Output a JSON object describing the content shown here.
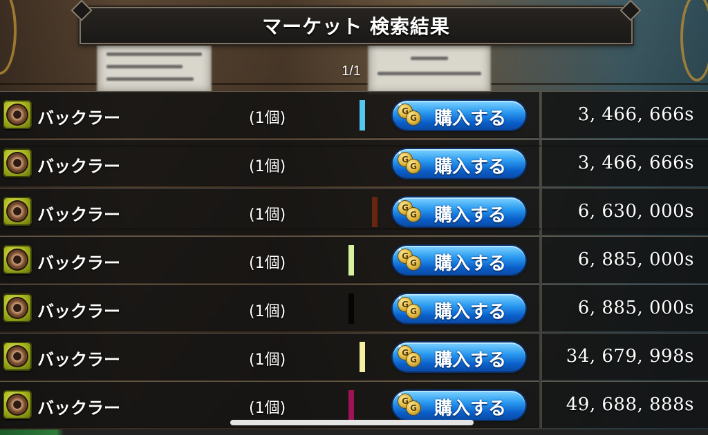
{
  "title": "マーケット 検索結果",
  "page_indicator": "1/1",
  "buy_label": "購入する",
  "listings": [
    {
      "name": "バックラー",
      "qty": "(1個)",
      "color": "#55c6f0",
      "price": "3, 466, 666s"
    },
    {
      "name": "バックラー",
      "qty": "(1個)",
      "color": "",
      "price": "3, 466, 666s"
    },
    {
      "name": "バックラー",
      "qty": "(1個)",
      "color": "#6a2412",
      "price": "6, 630, 000s"
    },
    {
      "name": "バックラー",
      "qty": "(1個)",
      "color": "#d6f2a0",
      "price": "6, 885, 000s"
    },
    {
      "name": "バックラー",
      "qty": "(1個)",
      "color": "#050505",
      "price": "6, 885, 000s"
    },
    {
      "name": "バックラー",
      "qty": "(1個)",
      "color": "#f5f0a0",
      "price": "34, 679, 998s"
    },
    {
      "name": "バックラー",
      "qty": "(1個)",
      "color": "#9c1456",
      "price": "49, 688, 888s"
    }
  ],
  "icons": {
    "item": "buckler-shield-icon",
    "buy": "coin-icon"
  }
}
